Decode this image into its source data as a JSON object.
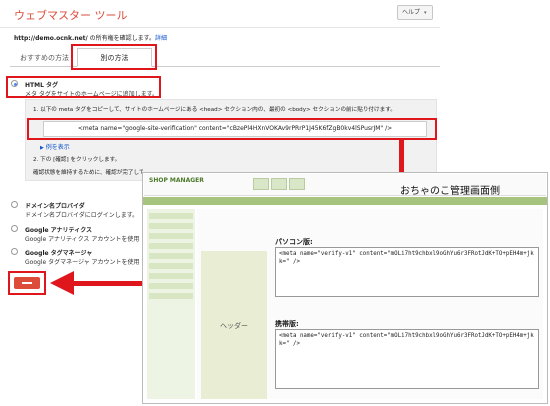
{
  "app": {
    "title": "ウェブマスター ツール",
    "help_label": "ヘルプ"
  },
  "owner": {
    "site": "http://demo.ocnk.net/",
    "text": " の所有権を確認します。",
    "link": "詳細"
  },
  "tabs": [
    {
      "label": "おすすめの方法"
    },
    {
      "label": "別の方法"
    }
  ],
  "options": [
    {
      "title": "HTML タグ",
      "desc": "メタ タグをサイトのホームページに追加します。"
    },
    {
      "title": "ドメイン名プロバイダ",
      "desc": "ドメイン名プロバイダにログインします。"
    },
    {
      "title": "Google アナリティクス",
      "desc": "Google アナリティクス アカウントを使用し"
    },
    {
      "title": "Google タグマネージャ",
      "desc": "Google タグマネージャ アカウントを使用し"
    }
  ],
  "steps": {
    "step1": "1. 以下の meta タグをコピーして、サイトのホームページにある <head> セクション内の、最初の <body> セクションの前に貼り付けます。",
    "meta": "<meta name=\"google-site-verification\" content=\"cBzePl4HXnVOKAv9rPRrP1J45K6fZgB0kv4lSPusrJM\" />",
    "examples": "例を表示",
    "step2": "2. 下の [確認] をクリックします。",
    "note": "確認状態を維持するために、確認が完了してもメタ タグを削除しないでください。"
  },
  "screenshot": {
    "caption": "おちゃのこ管理画面側",
    "logo": "SHOP MANAGER",
    "header_label": "ヘッダー",
    "pc_title": "パソコン版:",
    "pc_code": "<meta name=\"verify-v1\" content=\"mOLi7ht9chbxl9oGhYu6r3FRotJdK+TO+pEH4m+jkk=\" />",
    "mobile_title": "携帯版:",
    "mobile_code": "<meta name=\"verify-v1\" content=\"mOLi7ht9chbxl9oGhYu6r3FRotJdK+TO+pEH4m+jkk=\" />"
  },
  "colors": {
    "highlight": "#e0161d",
    "brand": "#dd4b39",
    "link": "#1155cc",
    "shop_green": "#a7c47f"
  }
}
